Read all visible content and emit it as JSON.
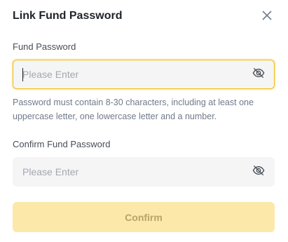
{
  "dialog": {
    "title": "Link Fund Password",
    "close_icon": "close-icon"
  },
  "fund_password": {
    "label": "Fund Password",
    "placeholder": "Please Enter",
    "value": "",
    "visibility_icon": "eye-hidden-icon",
    "focused": true
  },
  "hint": {
    "text": "Password must contain 8-30 characters, including at least one uppercase letter, one lowercase letter and a number."
  },
  "confirm_fund_password": {
    "label": "Confirm Fund Password",
    "placeholder": "Please Enter",
    "value": "",
    "visibility_icon": "eye-hidden-icon"
  },
  "actions": {
    "confirm_label": "Confirm",
    "confirm_disabled": true
  },
  "colors": {
    "accent": "#f0b90b",
    "accent_disabled_bg": "#fce8a8",
    "input_bg": "#f5f5f5",
    "text_primary": "#1e2329",
    "text_secondary": "#707a8a"
  }
}
